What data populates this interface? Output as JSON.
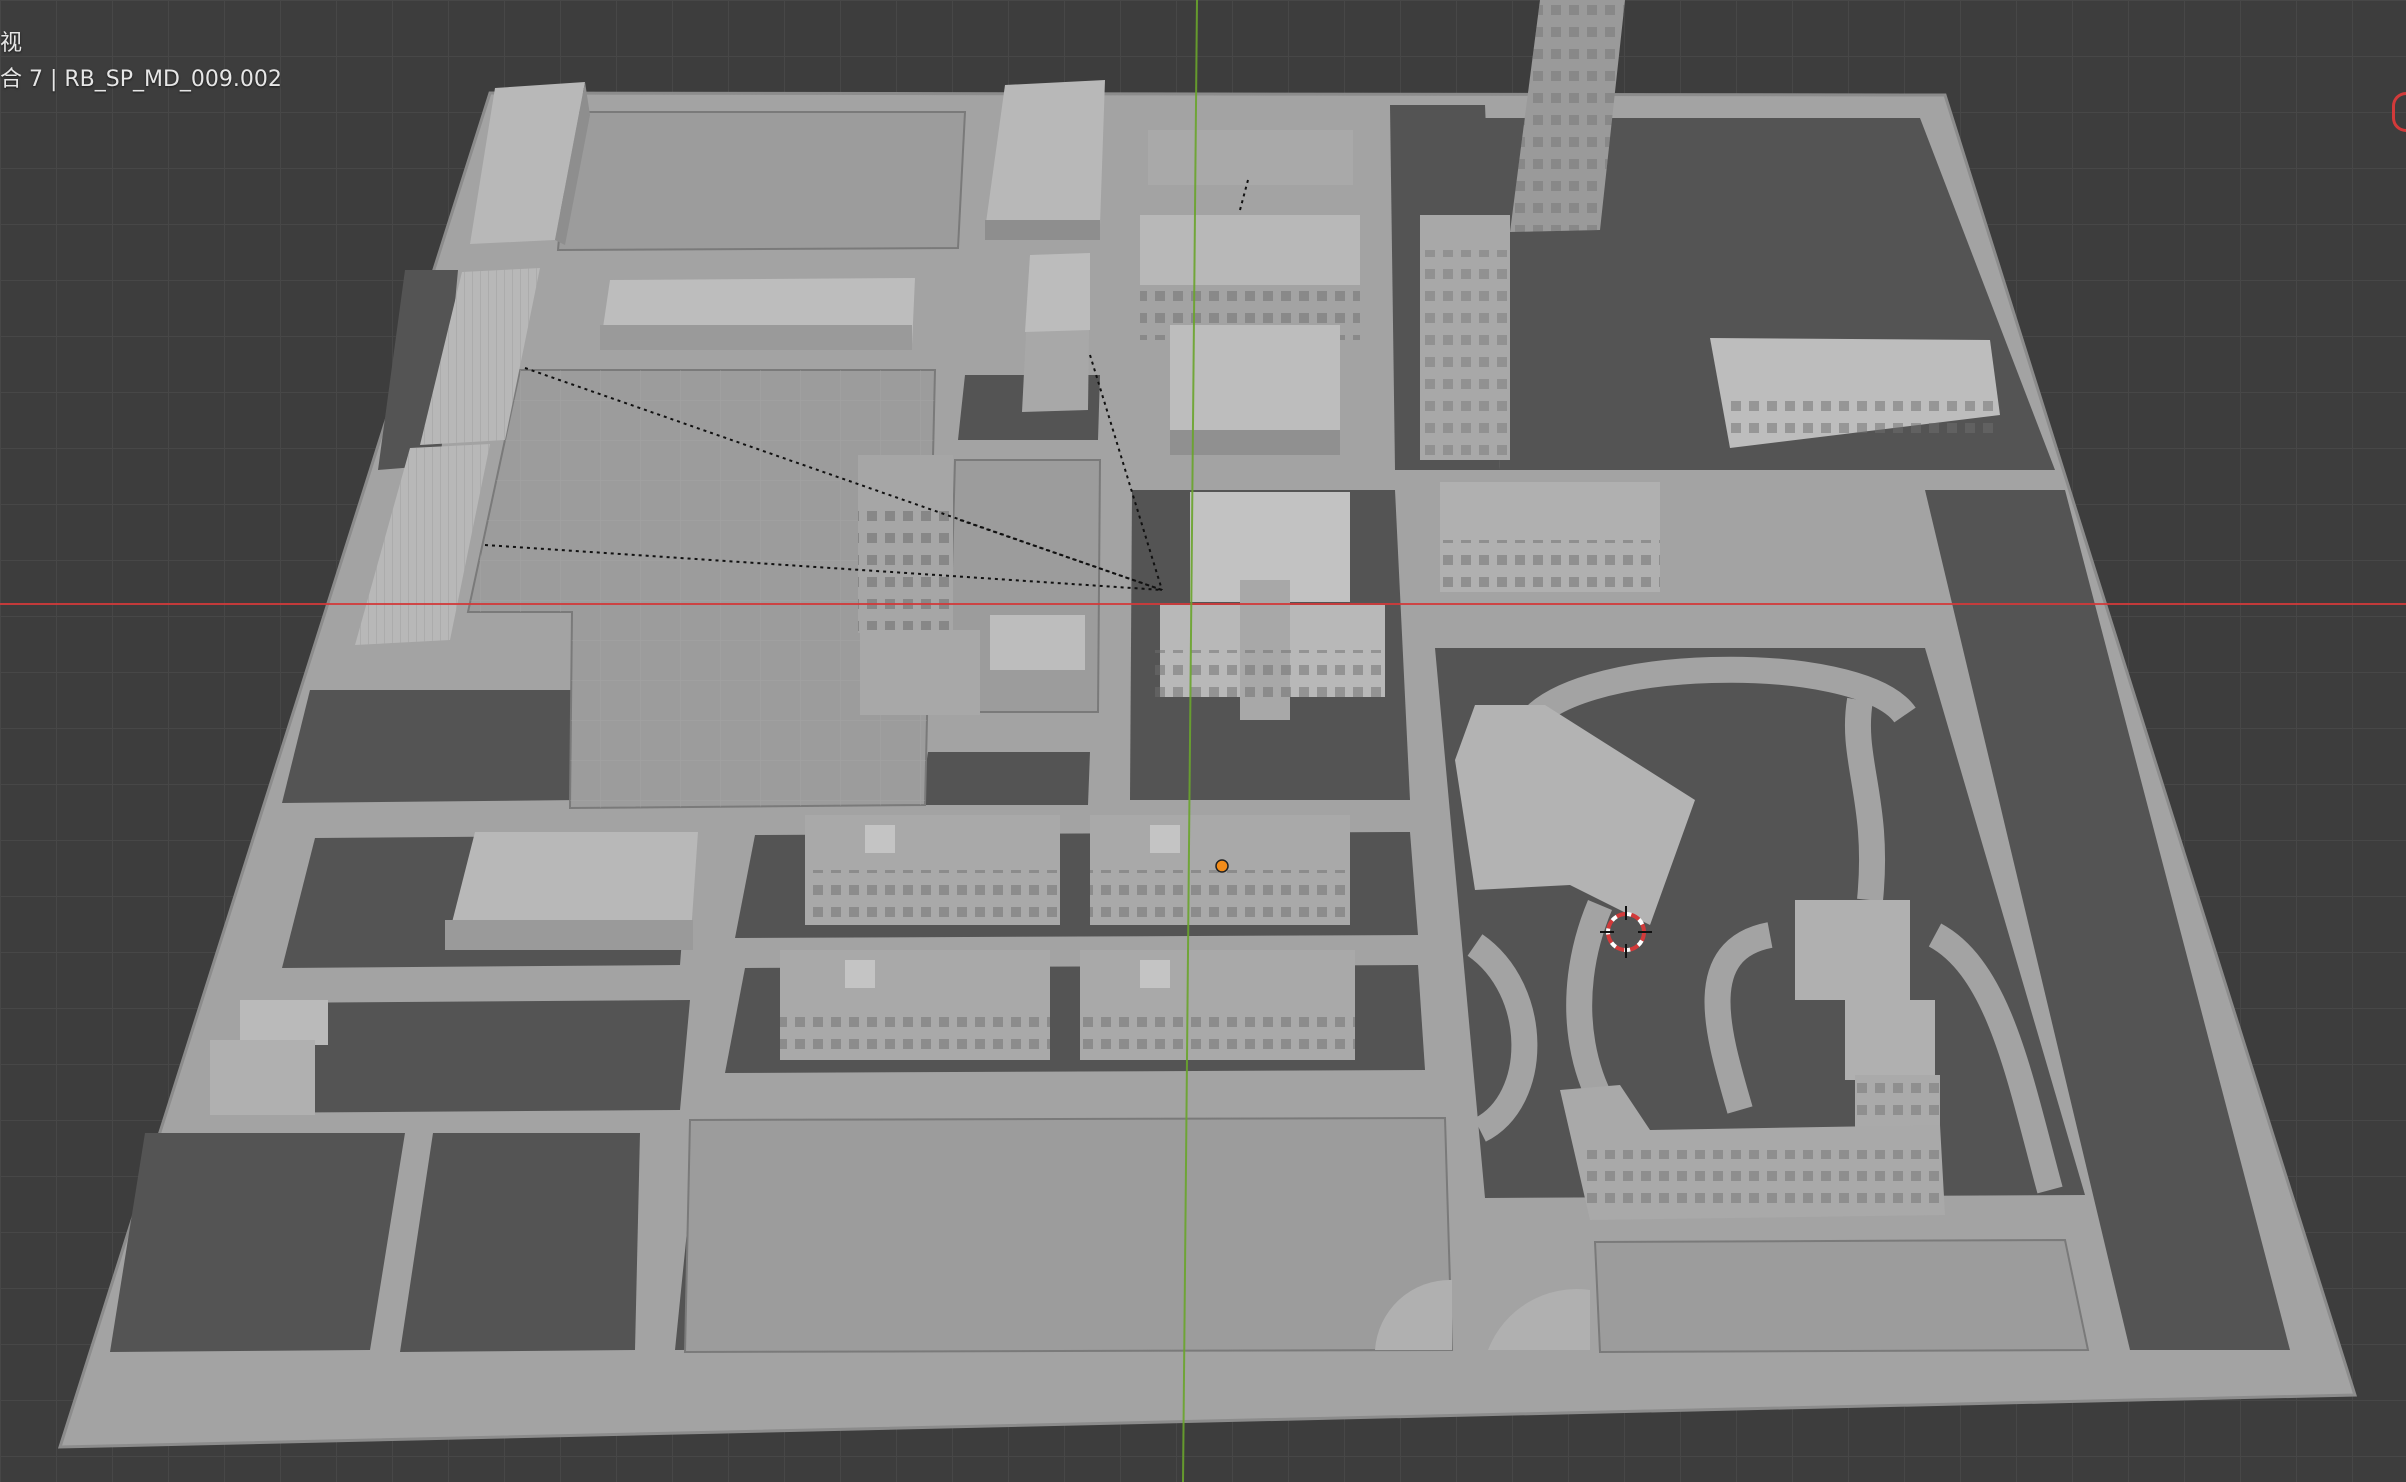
{
  "viewport": {
    "view_name": "视",
    "collection_info": "合 7 | RB_SP_MD_009.002"
  },
  "colors": {
    "background": "#3d3d3d",
    "grid": "#474747",
    "ground": "#a3a3a3",
    "ground_edge": "#8c8c8c",
    "block": "#545454",
    "plaza": "#9c9c9c",
    "building_top": "#b8b8b8",
    "building_side": "#8e8e8e",
    "axis_x": "#d23a3a",
    "axis_y": "#6aa52c",
    "origin": "#f28c1a"
  },
  "icons": [
    "origin-dot-icon",
    "3d-cursor-icon",
    "navigation-gizmo-icon"
  ]
}
